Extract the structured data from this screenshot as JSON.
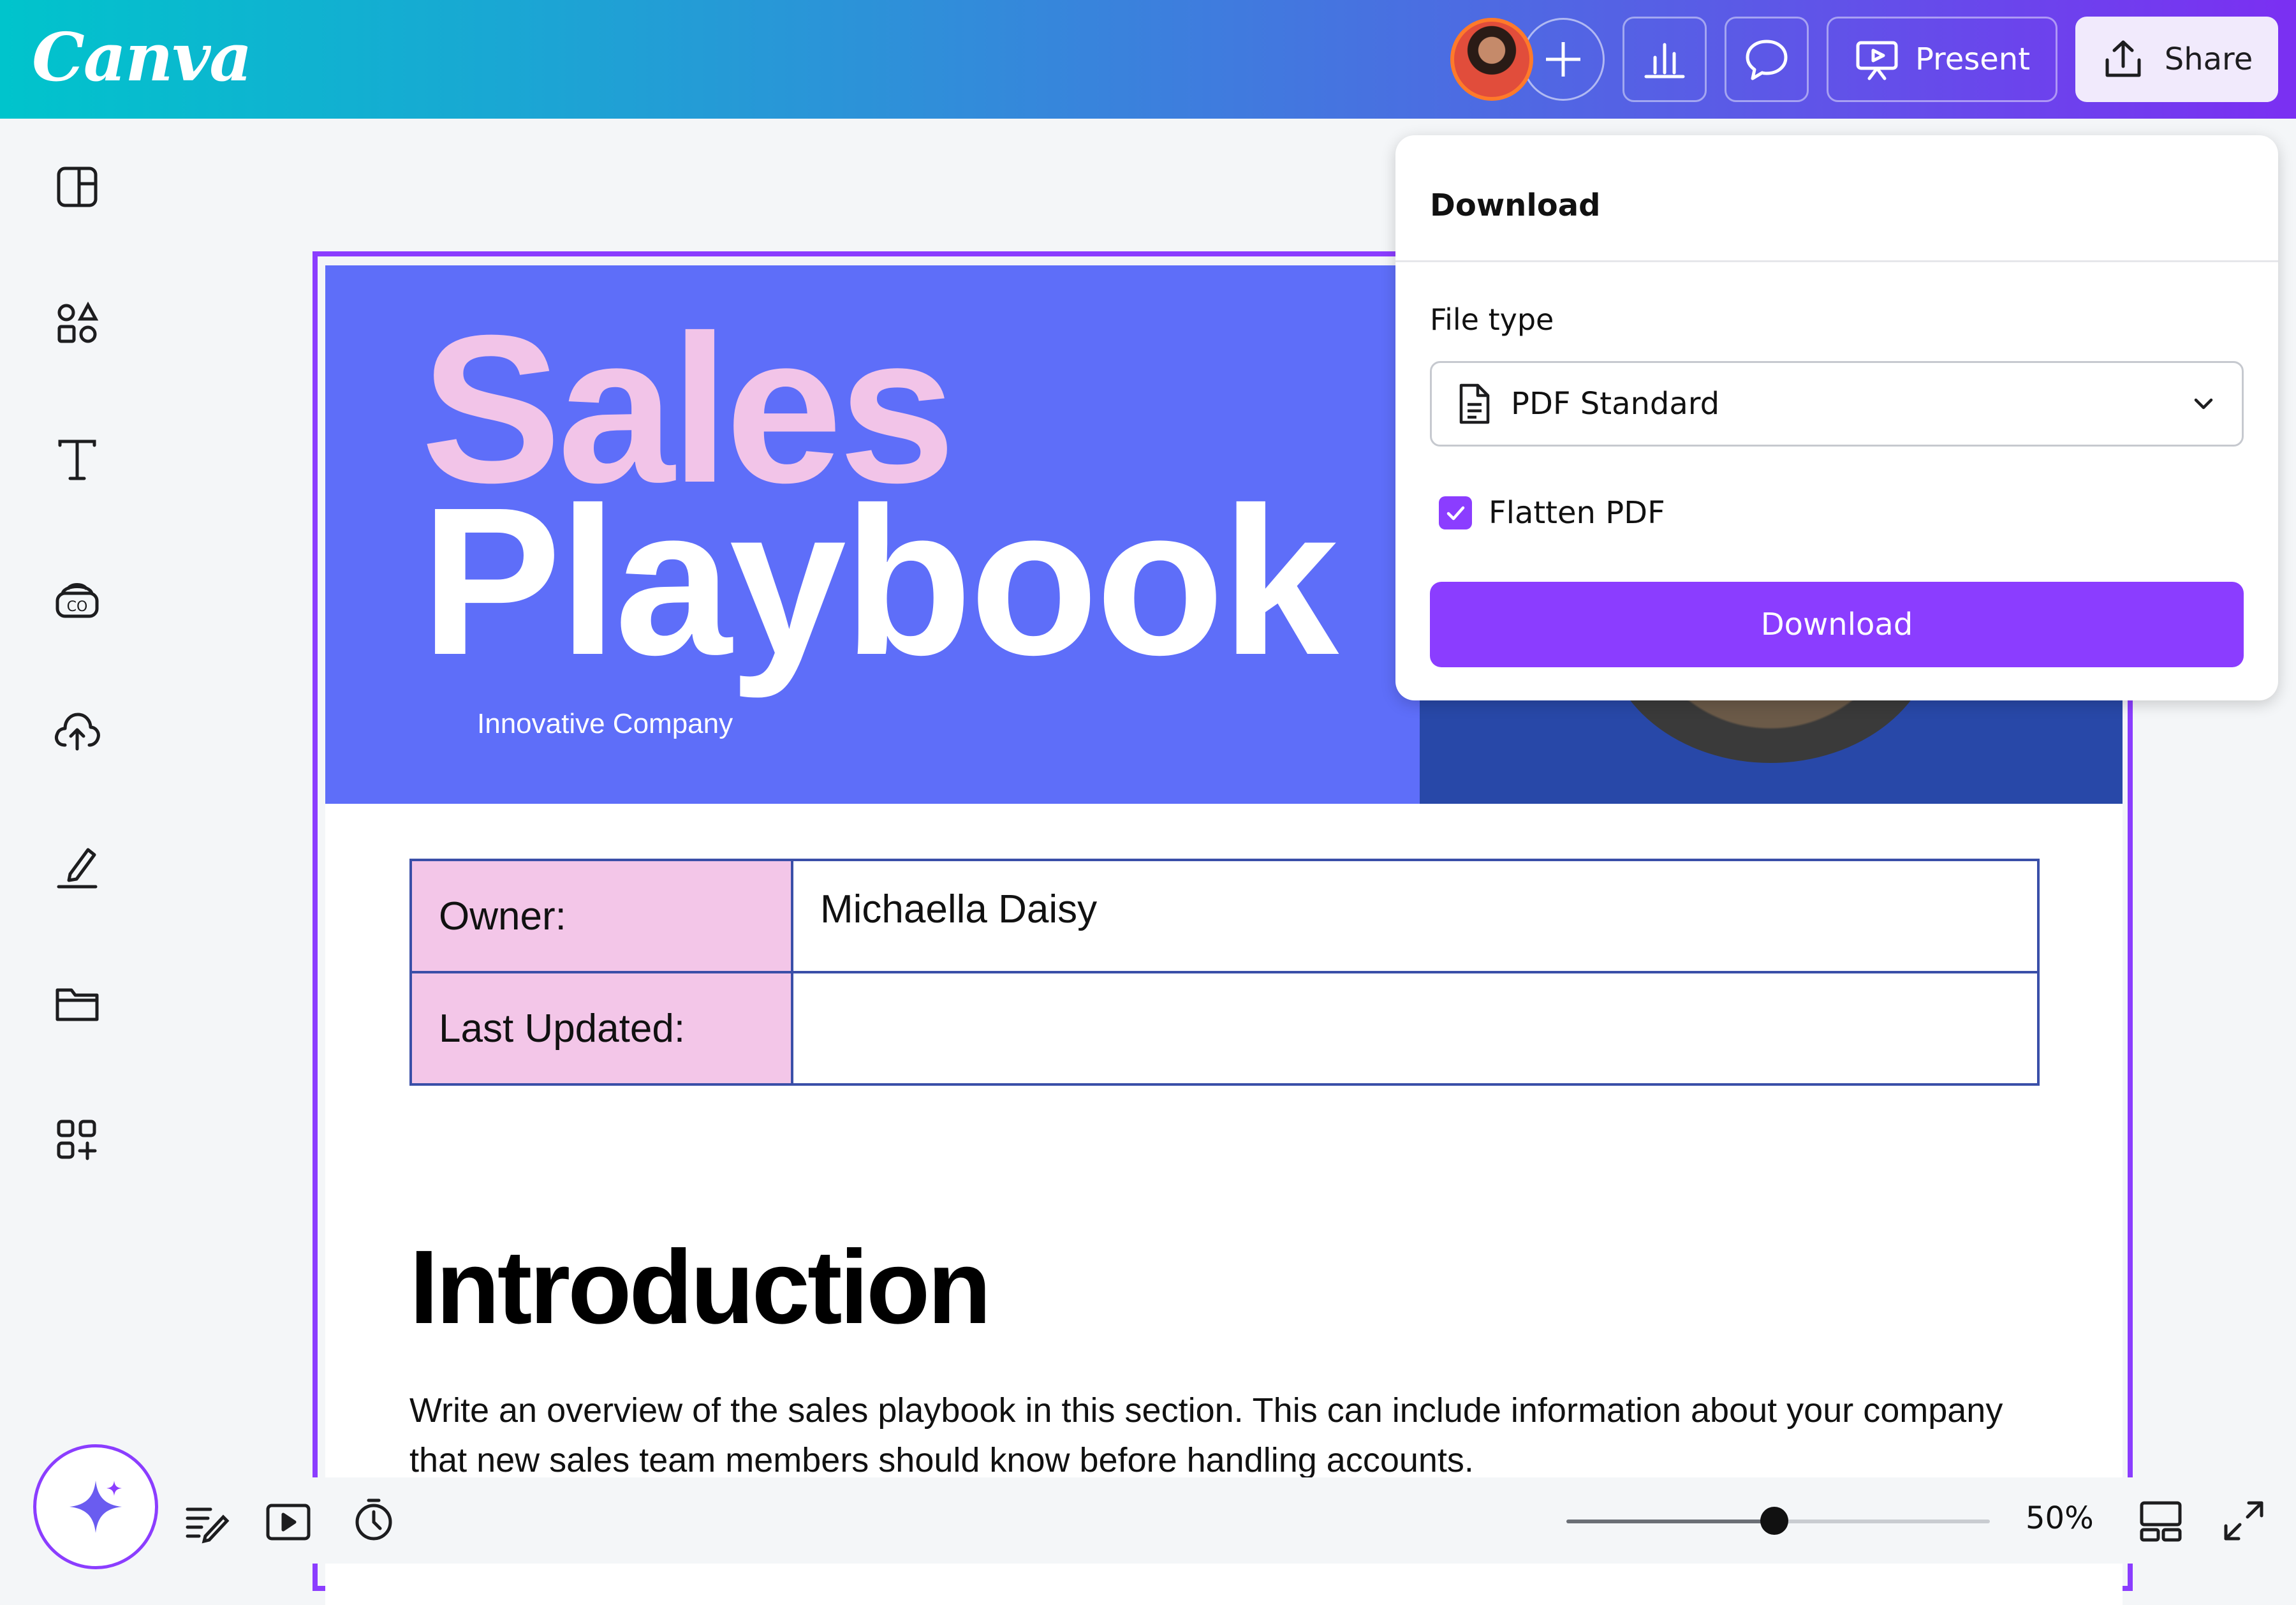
{
  "app": {
    "logo_text": "Canva"
  },
  "topbar": {
    "avatar_label": "Collaborator avatar",
    "present_label": "Present",
    "share_label": "Share"
  },
  "left_rail": {
    "items": [
      "design-icon",
      "elements-icon",
      "text-icon",
      "brand-icon",
      "uploads-icon",
      "draw-icon",
      "projects-icon",
      "apps-icon"
    ]
  },
  "document": {
    "title_line1": "Sales",
    "title_line2": "Playbook",
    "subtitle": "Innovative Company",
    "info_table": {
      "rows": [
        {
          "key": "Owner:",
          "value": "Michaella Daisy"
        },
        {
          "key": "Last Updated:",
          "value": ""
        }
      ]
    },
    "intro_heading": "Introduction",
    "intro_text": "Write an overview of the sales playbook in this section. This can include information about your company that new sales team members should know before handling accounts."
  },
  "download_panel": {
    "title": "Download",
    "file_type_label": "File type",
    "file_type_value": "PDF Standard",
    "flatten_label": "Flatten PDF",
    "flatten_checked": true,
    "download_button": "Download"
  },
  "bottombar": {
    "zoom_value": "50%",
    "zoom_fraction": 0.5
  },
  "colors": {
    "accent": "#8b3dff",
    "hero_blue": "#5e6ef9",
    "title_pink": "#f2c4e8",
    "table_key_bg": "#f3c6e8"
  }
}
